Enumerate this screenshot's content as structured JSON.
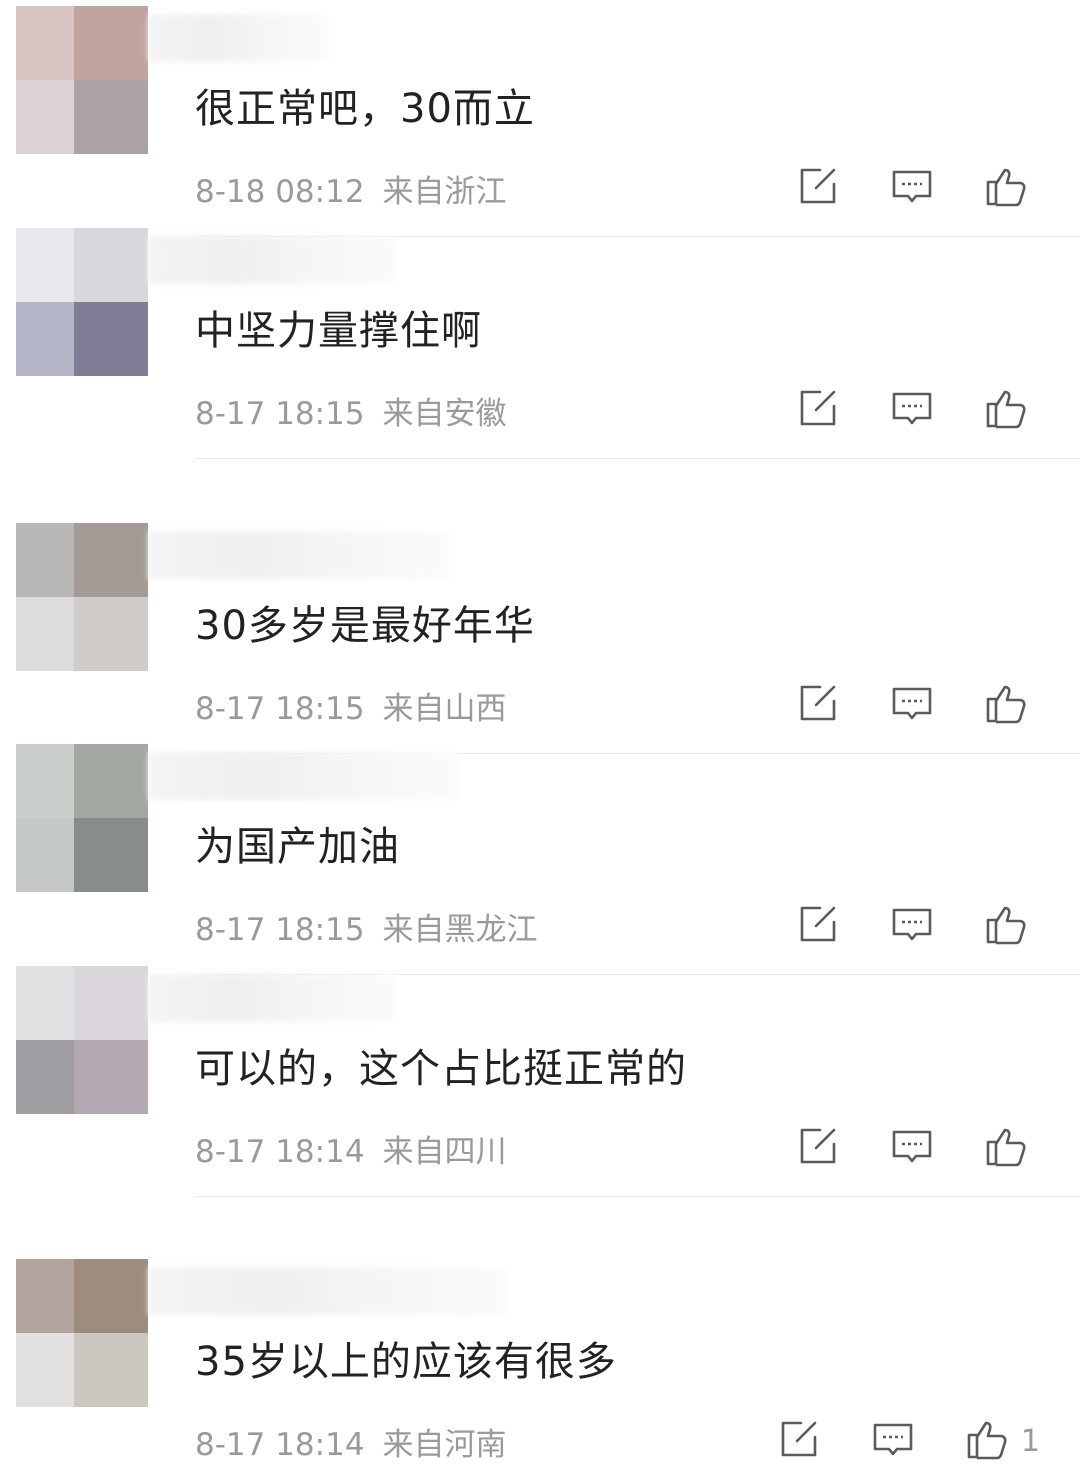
{
  "comments": [
    {
      "text": "很正常吧，30而立",
      "time": "8-18 08:12",
      "location": "来自浙江",
      "likes": "",
      "avatar_colors": [
        "#d9c4c2",
        "#bfa39d",
        "#ddd3d5",
        "#aea3a4"
      ]
    },
    {
      "text": "中坚力量撑住啊",
      "time": "8-17 18:15",
      "location": "来自安徽",
      "likes": "",
      "avatar_colors": [
        "#e6e8eb",
        "#d7d8db",
        "#b4b6c7",
        "#807d97"
      ]
    },
    {
      "text": "30多岁是最好年华",
      "time": "8-17 18:15",
      "location": "来自山西",
      "likes": "",
      "avatar_colors": [
        "#b9b6b6",
        "#a39b95",
        "#dddcdc",
        "#cfccc9"
      ]
    },
    {
      "text": "为国产加油",
      "time": "8-17 18:15",
      "location": "来自黑龙江",
      "likes": "",
      "avatar_colors": [
        "#c9cfca",
        "#a1a8a0",
        "#c4c9c5",
        "#878d88"
      ]
    },
    {
      "text": "可以的，这个占比挺正常的",
      "time": "8-17 18:14",
      "location": "来自四川",
      "likes": "",
      "avatar_colors": [
        "#e0dfe2",
        "#dad6dc",
        "#a09ea3",
        "#b4a9b2"
      ]
    },
    {
      "text": "35岁以上的应该有很多",
      "time": "8-17 18:14",
      "location": "来自河南",
      "likes": "1",
      "avatar_colors": [
        "#b1a59d",
        "#9f8b80",
        "#e2e1df",
        "#cdc7c2"
      ]
    }
  ],
  "icons": {
    "share": "share-icon",
    "reply": "comment-icon",
    "like": "thumbs-up-icon"
  }
}
